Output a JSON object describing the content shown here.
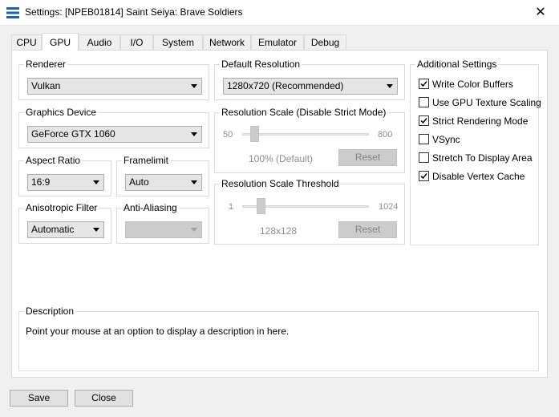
{
  "window": {
    "title": "Settings: [NPEB01814] Saint Seiya: Brave Soldiers",
    "close_glyph": "✕"
  },
  "tabs": [
    "CPU",
    "GPU",
    "Audio",
    "I/O",
    "System",
    "Network",
    "Emulator",
    "Debug"
  ],
  "active_tab": "GPU",
  "renderer": {
    "label": "Renderer",
    "value": "Vulkan"
  },
  "graphics_device": {
    "label": "Graphics Device",
    "value": "GeForce GTX 1060"
  },
  "aspect_ratio": {
    "label": "Aspect Ratio",
    "value": "16:9"
  },
  "framelimit": {
    "label": "Framelimit",
    "value": "Auto"
  },
  "anisotropic_filter": {
    "label": "Anisotropic Filter",
    "value": "Automatic"
  },
  "anti_aliasing": {
    "label": "Anti-Aliasing",
    "value": ""
  },
  "default_resolution": {
    "label": "Default Resolution",
    "value": "1280x720 (Recommended)"
  },
  "resolution_scale": {
    "label": "Resolution Scale (Disable Strict Mode)",
    "min": "50",
    "max": "800",
    "current": "100% (Default)",
    "reset": "Reset"
  },
  "resolution_scale_threshold": {
    "label": "Resolution Scale Threshold",
    "min": "1",
    "max": "1024",
    "current": "128x128",
    "reset": "Reset"
  },
  "additional_settings": {
    "label": "Additional Settings",
    "items": [
      {
        "label": "Write Color Buffers",
        "checked": true
      },
      {
        "label": "Use GPU Texture Scaling",
        "checked": false
      },
      {
        "label": "Strict Rendering Mode",
        "checked": true
      },
      {
        "label": "VSync",
        "checked": false
      },
      {
        "label": "Stretch To Display Area",
        "checked": false
      },
      {
        "label": "Disable Vertex Cache",
        "checked": true
      }
    ]
  },
  "description": {
    "label": "Description",
    "text": "Point your mouse at an option to display a description in here."
  },
  "footer": {
    "save": "Save",
    "close": "Close"
  },
  "colors": {
    "accent": "#1e5fbf",
    "panel_bg": "#ffffff",
    "window_bg": "#f0f0f0"
  }
}
